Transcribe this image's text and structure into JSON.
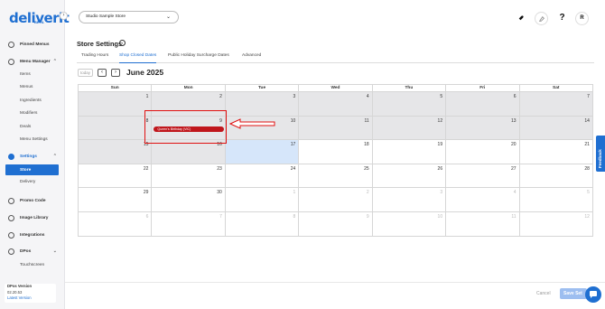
{
  "brand": {
    "logo": "deliverit",
    "tagline": "BETA"
  },
  "sidebar": {
    "items": [
      {
        "label": "Pinned Menus",
        "icon": "pin-icon"
      },
      {
        "label": "Menu Manager",
        "icon": "menu-icon"
      },
      {
        "label": "Items"
      },
      {
        "label": "Menus"
      },
      {
        "label": "Ingredients"
      },
      {
        "label": "Modifiers"
      },
      {
        "label": "Deals"
      },
      {
        "label": "Menu Settings"
      },
      {
        "label": "Settings",
        "icon": "gear-icon"
      },
      {
        "label": "Store"
      },
      {
        "label": "Delivery"
      },
      {
        "label": "Promo Code",
        "icon": "tag-icon"
      },
      {
        "label": "Image Library",
        "icon": "image-icon"
      },
      {
        "label": "Integrations",
        "icon": "plug-icon"
      },
      {
        "label": "DPos",
        "icon": "pos-icon"
      },
      {
        "label": "Touchscreen"
      }
    ],
    "footer": {
      "label": "DPos Version",
      "version": "02.20.53",
      "link": "Latest Version"
    }
  },
  "topbar": {
    "store": "Studio Sample Store",
    "help": "?",
    "avatar": "R"
  },
  "page": {
    "title": "Store Settings",
    "tabs": [
      "Trading Hours",
      "Shop Closed Dates",
      "Public Holiday Surcharge Dates",
      "Advanced"
    ],
    "active_tab": "Shop Closed Dates"
  },
  "calendar": {
    "today_label": "today",
    "month": "June 2025",
    "weekdays": [
      "Sun",
      "Mon",
      "Tue",
      "Wed",
      "Thu",
      "Fri",
      "Sat"
    ],
    "weeks": [
      [
        1,
        2,
        3,
        4,
        5,
        6,
        7
      ],
      [
        8,
        9,
        10,
        11,
        12,
        13,
        14
      ],
      [
        15,
        16,
        17,
        18,
        19,
        20,
        21
      ],
      [
        22,
        23,
        24,
        25,
        26,
        27,
        28
      ],
      [
        29,
        30,
        1,
        2,
        3,
        4,
        5
      ],
      [
        6,
        7,
        8,
        9,
        10,
        11,
        12
      ]
    ],
    "event": {
      "label": "Queen's Birthday (VIC)",
      "date": 9
    }
  },
  "feedback": "Feedback",
  "actions": {
    "cancel": "Cancel",
    "save": "Save Set"
  },
  "colors": {
    "accent": "#1f6fd1",
    "event": "#c0161c",
    "closed": "#e6e6e8",
    "today": "#d6e6fa",
    "annotation": "#e01010"
  }
}
